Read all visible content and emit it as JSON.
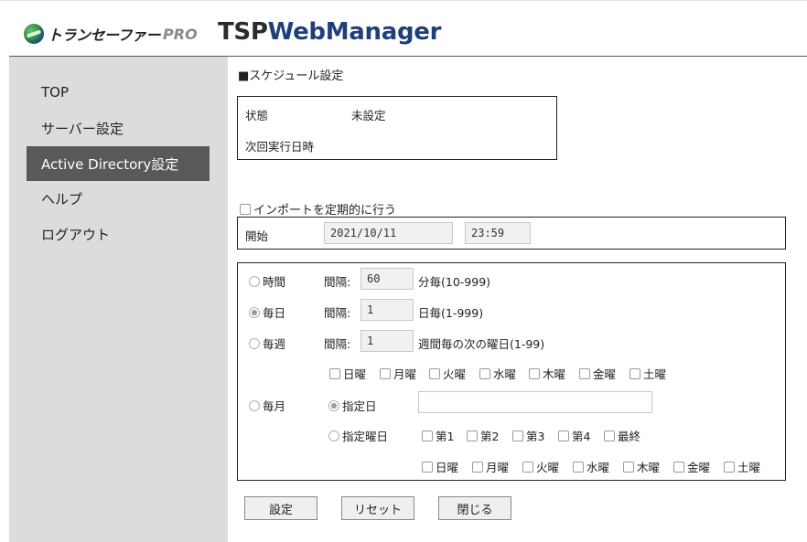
{
  "header": {
    "logo_text": "トランセーファー",
    "logo_pro": "PRO",
    "title_part1": "TSP",
    "title_part2": "WebManager"
  },
  "sidebar": {
    "items": [
      {
        "label": "TOP"
      },
      {
        "label": "サーバー設定"
      },
      {
        "label": "Active Directory設定",
        "active": true
      },
      {
        "label": "ヘルプ"
      },
      {
        "label": "ログアウト"
      }
    ]
  },
  "schedule": {
    "section_title": "■スケジュール設定",
    "status_label": "状態",
    "status_value": "未設定",
    "next_run_label": "次回実行日時",
    "next_run_value": ""
  },
  "periodic": {
    "checkbox_label": "インポートを定期的に行う",
    "checked": false,
    "start_label": "開始",
    "start_date": "2021/10/11",
    "start_time": "23:59"
  },
  "intervals": {
    "interval_label": "間隔:",
    "hourly": {
      "label": "時間",
      "value": "60",
      "unit": "分毎(10-999)",
      "selected": false
    },
    "daily": {
      "label": "毎日",
      "value": "1",
      "unit": "日毎(1-999)",
      "selected": true
    },
    "weekly": {
      "label": "毎週",
      "value": "1",
      "unit": "週間毎の次の曜日(1-99)",
      "selected": false,
      "days": [
        "日曜",
        "月曜",
        "火曜",
        "水曜",
        "木曜",
        "金曜",
        "土曜"
      ]
    },
    "monthly": {
      "label": "毎月",
      "selected": false,
      "specified_day_label": "指定日",
      "specified_day_value": "",
      "specified_weekday_label": "指定曜日",
      "weeks": [
        "第1",
        "第2",
        "第3",
        "第4",
        "最終"
      ],
      "days": [
        "日曜",
        "月曜",
        "火曜",
        "水曜",
        "木曜",
        "金曜",
        "土曜"
      ]
    }
  },
  "buttons": {
    "set": "設定",
    "reset": "リセット",
    "close": "閉じる"
  },
  "colors": {
    "sidebar_bg": "#dcdcdc",
    "active_nav_bg": "#595959",
    "title_accent": "#1f3f7a"
  }
}
